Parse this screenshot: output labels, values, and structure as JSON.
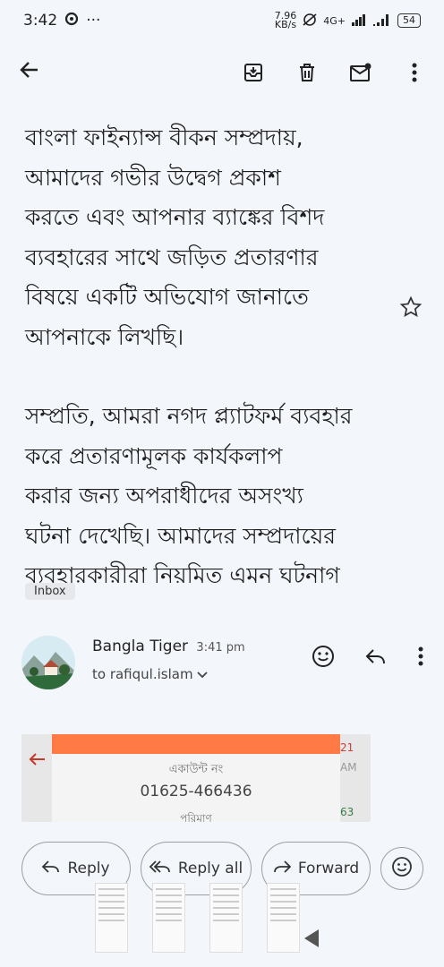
{
  "status_bar": {
    "time": "3:42",
    "dots": "···",
    "speed": "7.96",
    "speed_unit": "KB/s",
    "network": "4G+",
    "battery": "54"
  },
  "message": {
    "paragraph1": [
      "বাংলা ফাইন্যান্স বীকন সম্প্রদায়,",
      "আমাদের গভীর উদ্বেগ প্রকাশ",
      "করতে এবং আপনার ব্যাঙ্কের বিশদ",
      "ব্যবহারের সাথে জড়িত প্রতারণার",
      "বিষয়ে একটি অভিযোগ জানাতে",
      "আপনাকে লিখছি।"
    ],
    "paragraph2": [
      "সম্প্রতি, আমরা নগদ প্ল্যাটফর্ম ব্যবহার",
      "করে প্রতারণামূলক কার্যকলাপ",
      "করার জন্য অপরাধীদের অসংখ্য",
      "ঘটনা দেখেছি। আমাদের সম্প্রদায়ের",
      "ব্যবহারকারীরা নিয়মিত এমন ঘটনাগ"
    ],
    "label_chip": "Inbox"
  },
  "sender": {
    "name": "Bangla Tiger",
    "time": "3:41 pm",
    "to": "to rafiqul.islam"
  },
  "attachment": {
    "label": "একাউন্ট নং",
    "number": "01625-466436",
    "amount_label": "পরিমাণ",
    "side1": "21",
    "side2": "AM",
    "side3": "63"
  },
  "buttons": {
    "reply": "Reply",
    "reply_all": "Reply all",
    "forward": "Forward"
  },
  "colors": {
    "background": "#f3f6fb",
    "accent_orange": "#ff7a45"
  }
}
